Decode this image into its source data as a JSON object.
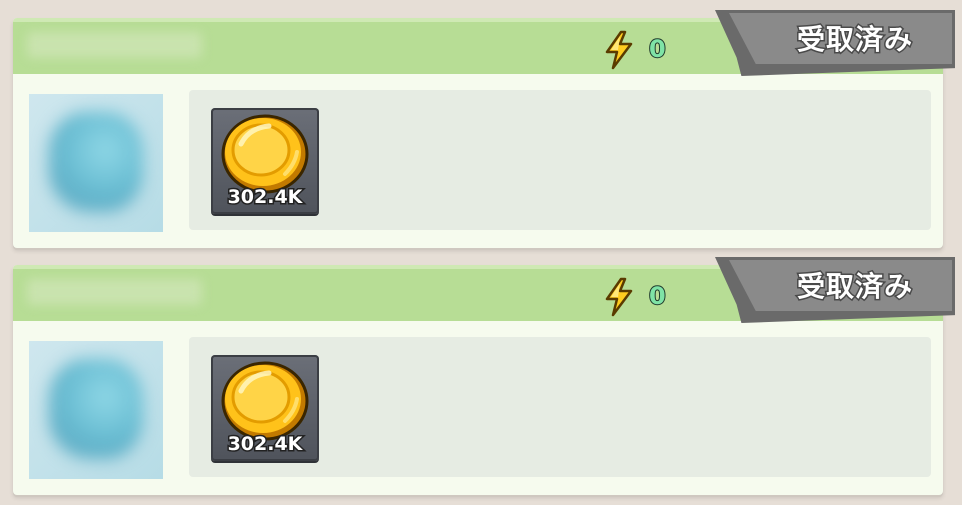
{
  "missions": [
    {
      "energy": "0",
      "status_label": "受取済み",
      "rewards": [
        {
          "icon": "gold-coin-icon",
          "amount": "302.4K"
        }
      ]
    },
    {
      "energy": "0",
      "status_label": "受取済み",
      "rewards": [
        {
          "icon": "gold-coin-icon",
          "amount": "302.4K"
        }
      ]
    }
  ],
  "colors": {
    "header_green": "#b7dd95",
    "card_bg": "#f6fbee",
    "badge_gray": "#8a8a8a",
    "energy_text": "#7fe3a6",
    "coin_gold": "#ffc21a"
  }
}
